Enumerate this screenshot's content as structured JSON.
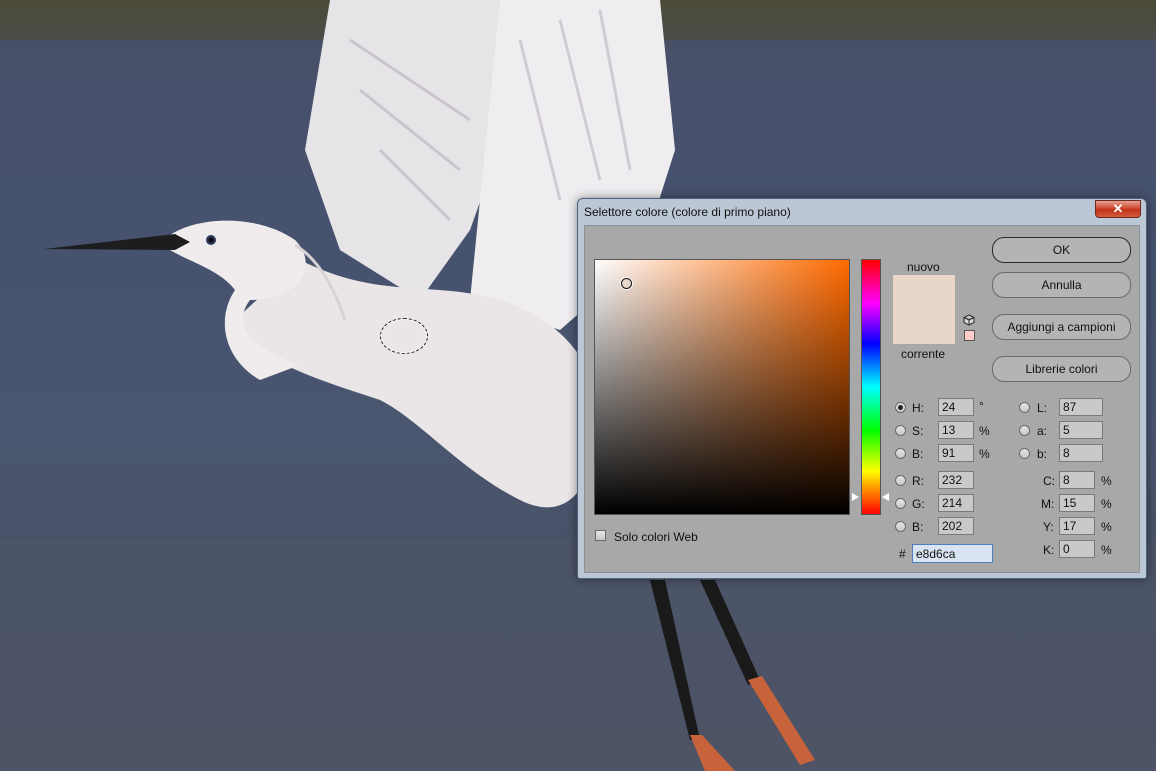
{
  "dialog": {
    "title": "Selettore colore (colore di primo piano)",
    "close_label": "✕"
  },
  "swatches": {
    "new_label": "nuovo",
    "current_label": "corrente",
    "new_color": "#e8d6ca",
    "current_color": "#e8d6ca",
    "websafe_color": "#ffcccc"
  },
  "buttons": {
    "ok": "OK",
    "cancel": "Annulla",
    "add_swatches": "Aggiungi a campioni",
    "color_libraries": "Librerie colori"
  },
  "hsb": {
    "h_label": "H:",
    "h_value": "24",
    "h_unit": "°",
    "s_label": "S:",
    "s_value": "13",
    "s_unit": "%",
    "b_label": "B:",
    "b_value": "91",
    "b_unit": "%"
  },
  "rgb": {
    "r_label": "R:",
    "r_value": "232",
    "g_label": "G:",
    "g_value": "214",
    "b_label": "B:",
    "b_value": "202"
  },
  "lab": {
    "l_label": "L:",
    "l_value": "87",
    "a_label": "a:",
    "a_value": "5",
    "b_label": "b:",
    "b_value": "8"
  },
  "cmyk": {
    "c_label": "C:",
    "c_value": "8",
    "c_unit": "%",
    "m_label": "M:",
    "m_value": "15",
    "m_unit": "%",
    "y_label": "Y:",
    "y_value": "17",
    "y_unit": "%",
    "k_label": "K:",
    "k_value": "0",
    "k_unit": "%"
  },
  "hex": {
    "label": "#",
    "value": "e8d6ca"
  },
  "web_only": {
    "label": "Solo colori Web"
  }
}
